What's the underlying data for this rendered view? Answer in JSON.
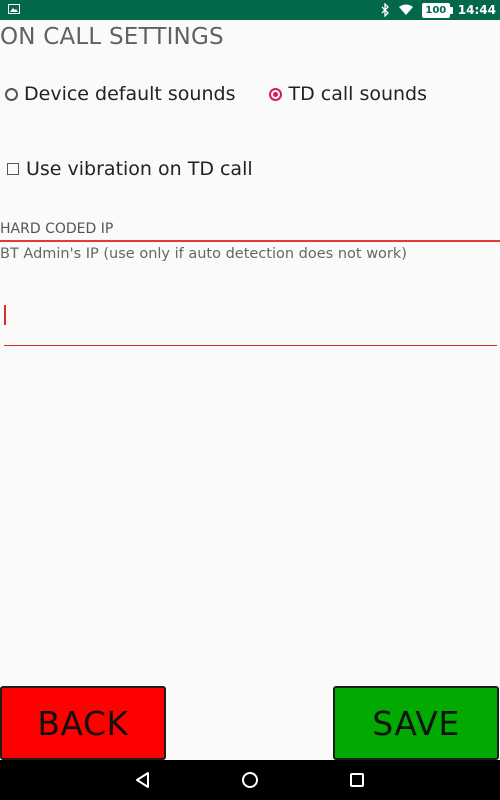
{
  "status_bar": {
    "left_icon": "picture-icon",
    "icons": [
      "bluetooth-icon",
      "wifi-icon"
    ],
    "battery": "100",
    "time": "14:44"
  },
  "page": {
    "title": "ON CALL SETTINGS"
  },
  "sound_options": {
    "options": [
      {
        "label": "Device default sounds",
        "checked": false
      },
      {
        "label": "TD call sounds",
        "checked": true
      }
    ]
  },
  "vibration": {
    "label": "Use vibration on TD call",
    "checked": false
  },
  "hard_coded_ip": {
    "header": "HARD CODED IP",
    "help": "BT Admin's IP (use only if auto detection does not work)",
    "value": "",
    "placeholder": ""
  },
  "buttons": {
    "back": "BACK",
    "save": "SAVE"
  },
  "colors": {
    "status_bar": "#03684b",
    "accent": "#d81b60",
    "field_line": "#d32f2f",
    "back_button": "#ff0000",
    "save_button": "#00aa00"
  },
  "nav_bar": {
    "items": [
      "back-icon",
      "home-icon",
      "recents-icon"
    ]
  }
}
